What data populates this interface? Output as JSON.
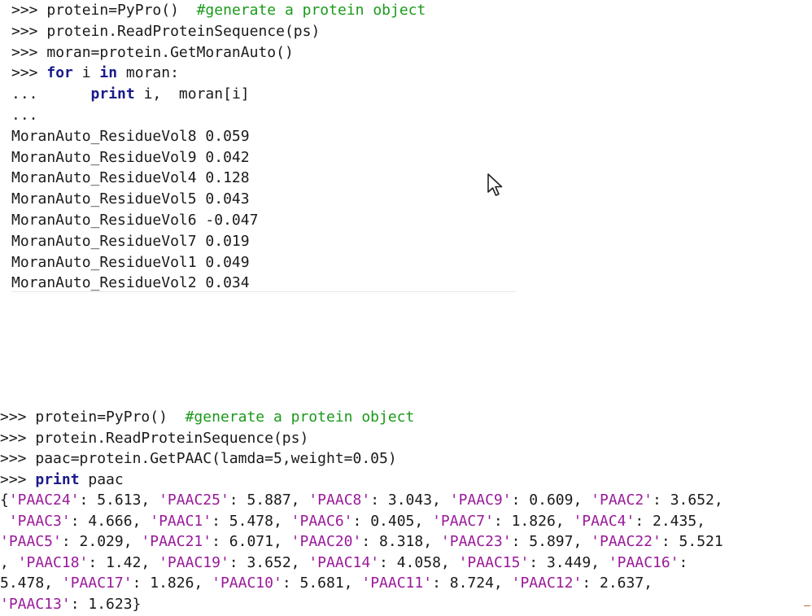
{
  "pane1": {
    "lines": [
      {
        "prompt": ">>> ",
        "code": "protein=PyPro()  ",
        "comment": "#generate a protein object"
      },
      {
        "prompt": ">>> ",
        "code": "protein.ReadProteinSequence(ps)"
      },
      {
        "prompt": ">>> ",
        "code": "moran=protein.GetMoranAuto()"
      },
      {
        "prompt": ">>> ",
        "kw1": "for",
        "mid": " i ",
        "kw2": "in",
        "tail": " moran:"
      },
      {
        "prompt": "...      ",
        "kw1": "print",
        "tail": " i,  moran[i]"
      },
      {
        "prompt": "..."
      }
    ],
    "output": [
      "MoranAuto_ResidueVol8 0.059",
      "MoranAuto_ResidueVol9 0.042",
      "MoranAuto_ResidueVol4 0.128",
      "MoranAuto_ResidueVol5 0.043",
      "MoranAuto_ResidueVol6 -0.047",
      "MoranAuto_ResidueVol7 0.019",
      "MoranAuto_ResidueVol1 0.049",
      "MoranAuto_ResidueVol2 0.034"
    ]
  },
  "pane2": {
    "lines": [
      {
        "prompt": ">>> ",
        "code": "protein=PyPro()  ",
        "comment": "#generate a protein object"
      },
      {
        "prompt": ">>> ",
        "code": "protein.ReadProteinSequence(ps)"
      },
      {
        "prompt": ">>> ",
        "code": "paac=protein.GetPAAC(lamda=5,weight=0.05)"
      },
      {
        "prompt": ">>> ",
        "kw1": "print",
        "tail": " paac"
      }
    ],
    "dict_lines": [
      [
        [
          "{",
          ""
        ],
        [
          "'PAAC24'",
          "s"
        ],
        [
          ": 5.613, ",
          ""
        ],
        [
          "'PAAC25'",
          "s"
        ],
        [
          ": 5.887, ",
          ""
        ],
        [
          "'PAAC8'",
          "s"
        ],
        [
          ": 3.043, ",
          ""
        ],
        [
          "'PAAC9'",
          "s"
        ],
        [
          ": 0.609, ",
          ""
        ],
        [
          "'PAAC2'",
          "s"
        ],
        [
          ": 3.652,",
          ""
        ]
      ],
      [
        [
          " ",
          ""
        ],
        [
          "'PAAC3'",
          "s"
        ],
        [
          ": 4.666, ",
          ""
        ],
        [
          "'PAAC1'",
          "s"
        ],
        [
          ": 5.478, ",
          ""
        ],
        [
          "'PAAC6'",
          "s"
        ],
        [
          ": 0.405, ",
          ""
        ],
        [
          "'PAAC7'",
          "s"
        ],
        [
          ": 1.826, ",
          ""
        ],
        [
          "'PAAC4'",
          "s"
        ],
        [
          ": 2.435,",
          ""
        ]
      ],
      [
        [
          "'PAAC5'",
          "s"
        ],
        [
          ": 2.029, ",
          ""
        ],
        [
          "'PAAC21'",
          "s"
        ],
        [
          ": 6.071, ",
          ""
        ],
        [
          "'PAAC20'",
          "s"
        ],
        [
          ": 8.318, ",
          ""
        ],
        [
          "'PAAC23'",
          "s"
        ],
        [
          ": 5.897, ",
          ""
        ],
        [
          "'PAAC22'",
          "s"
        ],
        [
          ": 5.521",
          ""
        ]
      ],
      [
        [
          ", ",
          ""
        ],
        [
          "'PAAC18'",
          "s"
        ],
        [
          ": 1.42, ",
          ""
        ],
        [
          "'PAAC19'",
          "s"
        ],
        [
          ": 3.652, ",
          ""
        ],
        [
          "'PAAC14'",
          "s"
        ],
        [
          ": 4.058, ",
          ""
        ],
        [
          "'PAAC15'",
          "s"
        ],
        [
          ": 3.449, ",
          ""
        ],
        [
          "'PAAC16'",
          "s"
        ],
        [
          ":",
          ""
        ]
      ],
      [
        [
          "5.478, ",
          ""
        ],
        [
          "'PAAC17'",
          "s"
        ],
        [
          ": 1.826, ",
          ""
        ],
        [
          "'PAAC10'",
          "s"
        ],
        [
          ": 5.681, ",
          ""
        ],
        [
          "'PAAC11'",
          "s"
        ],
        [
          ": 8.724, ",
          ""
        ],
        [
          "'PAAC12'",
          "s"
        ],
        [
          ": 2.637,",
          ""
        ]
      ],
      [
        [
          "'PAAC13'",
          "s"
        ],
        [
          ": 1.623}",
          ""
        ]
      ]
    ]
  },
  "colors": {
    "keyword": "#1a1a8c",
    "comment": "#1a9a1a",
    "string": "#9a1a9a"
  },
  "icons": {
    "cursor": "mouse-pointer-icon"
  }
}
